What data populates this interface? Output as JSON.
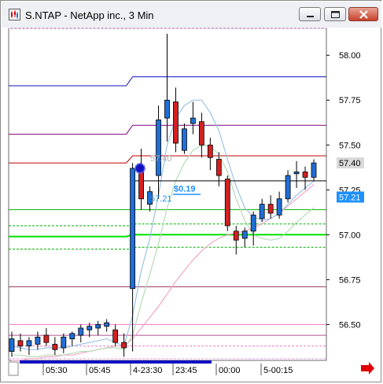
{
  "window": {
    "title": "S.NTAP - NetApp inc., 3 Min",
    "minimize_icon": "minimize-icon",
    "restore_icon": "restore-icon",
    "close_icon": "close-icon"
  },
  "colors": {
    "bull": "#1f6fd6",
    "bear": "#d42020",
    "avg_blue": "#9dc3e6",
    "avg_green": "#b5dcb5",
    "avg_pink": "#f2a6c8",
    "entry_line": "#000000",
    "last_tag_bg": "#d9d9d9",
    "current_tag_bg": "#1e90ff"
  },
  "chart_data": {
    "type": "candlestick",
    "title": "",
    "y_ticks": [
      "58.00",
      "57.75",
      "57.50",
      "57.25",
      "57.00",
      "56.75",
      "56.50"
    ],
    "y_tick_values": [
      58.0,
      57.75,
      57.5,
      57.25,
      57.0,
      56.75,
      56.5
    ],
    "ylim": [
      56.3,
      58.15
    ],
    "x_labels": [
      "05:30",
      "05:45",
      "4-23:30",
      "23:45",
      "00:00",
      "5-00:15"
    ],
    "candles": [
      {
        "o": 56.35,
        "h": 56.46,
        "l": 56.32,
        "c": 56.42
      },
      {
        "o": 56.41,
        "h": 56.45,
        "l": 56.35,
        "c": 56.38
      },
      {
        "o": 56.38,
        "h": 56.43,
        "l": 56.33,
        "c": 56.41
      },
      {
        "o": 56.39,
        "h": 56.46,
        "l": 56.36,
        "c": 56.43
      },
      {
        "o": 56.44,
        "h": 56.48,
        "l": 56.38,
        "c": 56.4
      },
      {
        "o": 56.39,
        "h": 56.43,
        "l": 56.33,
        "c": 56.36
      },
      {
        "o": 56.37,
        "h": 56.45,
        "l": 56.34,
        "c": 56.43
      },
      {
        "o": 56.42,
        "h": 56.46,
        "l": 56.38,
        "c": 56.45
      },
      {
        "o": 56.44,
        "h": 56.5,
        "l": 56.4,
        "c": 56.48
      },
      {
        "o": 56.47,
        "h": 56.51,
        "l": 56.43,
        "c": 56.49
      },
      {
        "o": 56.48,
        "h": 56.52,
        "l": 56.44,
        "c": 56.5
      },
      {
        "o": 56.49,
        "h": 56.53,
        "l": 56.46,
        "c": 56.51
      },
      {
        "o": 56.47,
        "h": 56.5,
        "l": 56.38,
        "c": 56.4
      },
      {
        "o": 56.4,
        "h": 56.45,
        "l": 56.32,
        "c": 56.37
      },
      {
        "o": 56.7,
        "h": 57.4,
        "l": 56.35,
        "c": 57.37
      },
      {
        "o": 57.37,
        "h": 57.48,
        "l": 57.14,
        "c": 57.2
      },
      {
        "o": 57.17,
        "h": 57.27,
        "l": 57.13,
        "c": 57.24
      },
      {
        "o": 57.33,
        "h": 57.72,
        "l": 57.2,
        "c": 57.64
      },
      {
        "o": 57.65,
        "h": 58.12,
        "l": 57.52,
        "c": 57.75
      },
      {
        "o": 57.74,
        "h": 57.82,
        "l": 57.46,
        "c": 57.51
      },
      {
        "o": 57.47,
        "h": 57.62,
        "l": 57.45,
        "c": 57.59
      },
      {
        "o": 57.62,
        "h": 57.74,
        "l": 57.56,
        "c": 57.65
      },
      {
        "o": 57.63,
        "h": 57.68,
        "l": 57.43,
        "c": 57.5
      },
      {
        "o": 57.5,
        "h": 57.54,
        "l": 57.36,
        "c": 57.43
      },
      {
        "o": 57.42,
        "h": 57.46,
        "l": 57.27,
        "c": 57.33
      },
      {
        "o": 57.31,
        "h": 57.33,
        "l": 57.02,
        "c": 57.05
      },
      {
        "o": 57.02,
        "h": 57.05,
        "l": 56.89,
        "c": 56.97
      },
      {
        "o": 56.98,
        "h": 57.04,
        "l": 56.93,
        "c": 57.02
      },
      {
        "o": 57.02,
        "h": 57.13,
        "l": 56.94,
        "c": 57.11
      },
      {
        "o": 57.09,
        "h": 57.2,
        "l": 57.07,
        "c": 57.17
      },
      {
        "o": 57.17,
        "h": 57.22,
        "l": 57.09,
        "c": 57.12
      },
      {
        "o": 57.11,
        "h": 57.24,
        "l": 57.09,
        "c": 57.2
      },
      {
        "o": 57.2,
        "h": 57.36,
        "l": 57.18,
        "c": 57.33
      },
      {
        "o": 57.34,
        "h": 57.41,
        "l": 57.26,
        "c": 57.35
      },
      {
        "o": 57.35,
        "h": 57.38,
        "l": 57.25,
        "c": 57.32
      },
      {
        "o": 57.32,
        "h": 57.42,
        "l": 57.3,
        "c": 57.4
      }
    ],
    "horizontal_levels": [
      {
        "value": 58.15,
        "color": "#f5a6f5",
        "style": "dash",
        "x0": 0.0,
        "x1": 0.36
      },
      {
        "value": 58.15,
        "color": "#f5a6f5",
        "style": "dash",
        "x0": 0.36,
        "x1": 1.0
      },
      {
        "value": 57.87,
        "color": "#1010c0",
        "style": "solid",
        "steps": [
          [
            0.0,
            57.83
          ],
          [
            0.37,
            57.83
          ],
          [
            0.39,
            57.88
          ],
          [
            1.0,
            57.88
          ]
        ]
      },
      {
        "value": 57.6,
        "color": "#800080",
        "style": "solid",
        "steps": [
          [
            0.0,
            57.56
          ],
          [
            0.37,
            57.56
          ],
          [
            0.39,
            57.61
          ],
          [
            1.0,
            57.61
          ]
        ]
      },
      {
        "value": 57.43,
        "color": "#c00000",
        "style": "solid",
        "steps": [
          [
            0.0,
            57.4
          ],
          [
            0.37,
            57.4
          ],
          [
            0.39,
            57.44
          ],
          [
            1.0,
            57.44
          ]
        ]
      },
      {
        "value": 57.14,
        "color": "#00b000",
        "style": "solid",
        "steps": [
          [
            0.0,
            57.14
          ],
          [
            1.0,
            57.14
          ]
        ]
      },
      {
        "value": 57.06,
        "color": "#00b000",
        "style": "dash",
        "steps": [
          [
            0.0,
            57.05
          ],
          [
            0.38,
            57.05
          ],
          [
            0.4,
            57.06
          ],
          [
            1.0,
            57.06
          ]
        ]
      },
      {
        "value": 57.0,
        "color": "#00e000",
        "style": "bold",
        "steps": [
          [
            0.0,
            56.99
          ],
          [
            0.37,
            56.99
          ],
          [
            0.39,
            57.0
          ],
          [
            1.0,
            57.0
          ]
        ]
      },
      {
        "value": 56.93,
        "color": "#00b000",
        "style": "dash",
        "steps": [
          [
            0.0,
            56.92
          ],
          [
            0.38,
            56.92
          ],
          [
            0.4,
            56.93
          ],
          [
            1.0,
            56.93
          ]
        ]
      },
      {
        "value": 56.72,
        "color": "#a0406a",
        "style": "solid",
        "steps": [
          [
            0.0,
            56.71
          ],
          [
            1.0,
            56.71
          ]
        ]
      },
      {
        "value": 56.5,
        "color": "#f07ac8",
        "style": "solid",
        "steps": [
          [
            0.0,
            56.5
          ],
          [
            1.0,
            56.5
          ]
        ]
      },
      {
        "value": 56.44,
        "color": "#b05090",
        "style": "solid",
        "steps": [
          [
            0.0,
            56.44
          ],
          [
            1.0,
            56.44
          ]
        ]
      },
      {
        "value": 56.38,
        "color": "#f07ac8",
        "style": "dash",
        "steps": [
          [
            0.0,
            56.38
          ],
          [
            1.0,
            56.38
          ]
        ]
      },
      {
        "value": 56.32,
        "color": "#f5a6f5",
        "style": "dash",
        "steps": [
          [
            0.0,
            56.31
          ],
          [
            1.0,
            56.31
          ]
        ]
      }
    ],
    "entry_line": {
      "value": 57.3,
      "start": 0.385
    },
    "entry_price_label": "57.40",
    "stop_price_label": "57.21",
    "pnl_label": "$0.19",
    "last_price_tag": "57.40",
    "current_price_tag": "57.21",
    "last_price_tag_value": 57.4,
    "current_price_tag_value": 57.21,
    "avg_blue": [
      56.38,
      56.37,
      56.36,
      56.36,
      56.37,
      56.37,
      56.37,
      56.38,
      56.39,
      56.4,
      56.41,
      56.42,
      56.4,
      56.38,
      56.55,
      56.8,
      56.98,
      57.22,
      57.5,
      57.65,
      57.72,
      57.75,
      57.75,
      57.68,
      57.58,
      57.42,
      57.27,
      57.15,
      57.1,
      57.08,
      57.09,
      57.12,
      57.17,
      57.22,
      57.26,
      57.3
    ],
    "avg_green": [
      56.33,
      56.33,
      56.32,
      56.32,
      56.33,
      56.33,
      56.33,
      56.34,
      56.35,
      56.35,
      56.36,
      56.37,
      56.37,
      56.36,
      56.44,
      56.62,
      56.78,
      56.95,
      57.15,
      57.3,
      57.4,
      57.47,
      57.5,
      57.49,
      57.45,
      57.35,
      57.2,
      57.08,
      57.0,
      56.98,
      56.97,
      56.98,
      57.02,
      57.07,
      57.11,
      57.15
    ],
    "avg_pink": [
      56.3,
      56.3,
      56.31,
      56.31,
      56.32,
      56.32,
      56.33,
      56.33,
      56.34,
      56.35,
      56.36,
      56.37,
      56.38,
      56.38,
      56.42,
      56.48,
      56.54,
      56.6,
      56.67,
      56.74,
      56.8,
      56.86,
      56.91,
      56.95,
      56.98,
      57.0,
      57.01,
      57.02,
      57.04,
      57.06,
      57.09,
      57.12,
      57.16,
      57.2,
      57.24,
      57.28
    ]
  },
  "scrollbar": {
    "label": "time-scroll"
  }
}
